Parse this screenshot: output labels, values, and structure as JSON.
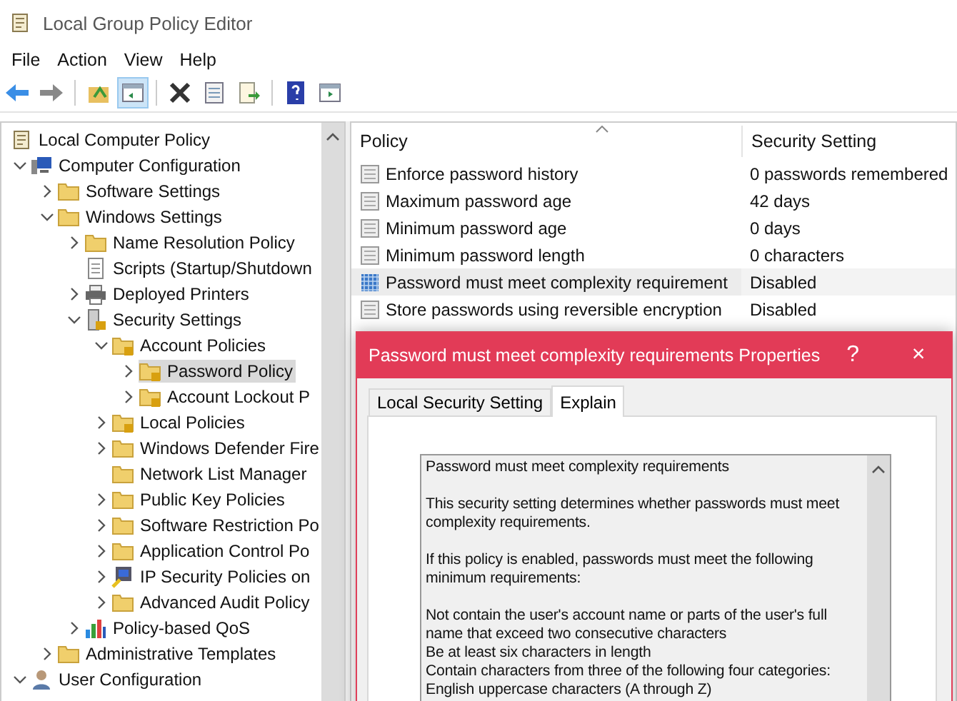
{
  "window": {
    "title": "Local Group Policy Editor"
  },
  "menu": [
    "File",
    "Action",
    "View",
    "Help"
  ],
  "toolbar": [
    {
      "kind": "back",
      "pressed": false
    },
    {
      "kind": "forward",
      "pressed": false
    },
    {
      "kind": "sep"
    },
    {
      "kind": "up",
      "pressed": false
    },
    {
      "kind": "tree",
      "pressed": true
    },
    {
      "kind": "sep"
    },
    {
      "kind": "delete",
      "pressed": false
    },
    {
      "kind": "properties",
      "pressed": false
    },
    {
      "kind": "export",
      "pressed": false
    },
    {
      "kind": "sep"
    },
    {
      "kind": "help",
      "pressed": false
    },
    {
      "kind": "pane",
      "pressed": false
    }
  ],
  "tree": [
    {
      "label": "Local Computer Policy",
      "kind": "scroll",
      "selected": false,
      "children": [
        {
          "label": "Computer Configuration",
          "kind": "computer",
          "expanded": true,
          "selected": false,
          "children": [
            {
              "label": "Software Settings",
              "kind": "folder",
              "expanded": false,
              "selected": false
            },
            {
              "label": "Windows Settings",
              "kind": "folder",
              "expanded": true,
              "selected": false,
              "children": [
                {
                  "label": "Name Resolution Policy",
                  "kind": "folder",
                  "expanded": false,
                  "selected": false
                },
                {
                  "label": "Scripts (Startup/Shutdown",
                  "kind": "script",
                  "selected": false
                },
                {
                  "label": "Deployed Printers",
                  "kind": "printer",
                  "expanded": false,
                  "selected": false
                },
                {
                  "label": "Security Settings",
                  "kind": "security",
                  "expanded": true,
                  "selected": false,
                  "children": [
                    {
                      "label": "Account Policies",
                      "kind": "lockfolder",
                      "expanded": true,
                      "selected": false,
                      "children": [
                        {
                          "label": "Password Policy",
                          "kind": "lockfolder",
                          "expanded": false,
                          "selected": true
                        },
                        {
                          "label": "Account Lockout P",
                          "kind": "lockfolder",
                          "expanded": false,
                          "selected": false
                        }
                      ]
                    },
                    {
                      "label": "Local Policies",
                      "kind": "lockfolder",
                      "expanded": false,
                      "selected": false
                    },
                    {
                      "label": "Windows Defender Fire",
                      "kind": "folder",
                      "expanded": false,
                      "selected": false
                    },
                    {
                      "label": "Network List Manager",
                      "kind": "folder",
                      "selected": false
                    },
                    {
                      "label": "Public Key Policies",
                      "kind": "folder",
                      "expanded": false,
                      "selected": false
                    },
                    {
                      "label": "Software Restriction Po",
                      "kind": "folder",
                      "expanded": false,
                      "selected": false
                    },
                    {
                      "label": "Application Control Po",
                      "kind": "folder",
                      "expanded": false,
                      "selected": false
                    },
                    {
                      "label": "IP Security Policies on",
                      "kind": "ipsec",
                      "expanded": false,
                      "selected": false
                    },
                    {
                      "label": "Advanced Audit Policy",
                      "kind": "folder",
                      "expanded": false,
                      "selected": false
                    }
                  ]
                },
                {
                  "label": "Policy-based QoS",
                  "kind": "chart",
                  "expanded": false,
                  "selected": false
                }
              ]
            },
            {
              "label": "Administrative Templates",
              "kind": "folder",
              "expanded": false,
              "selected": false
            }
          ]
        },
        {
          "label": "User Configuration",
          "kind": "user",
          "expanded": true,
          "selected": false
        }
      ]
    }
  ],
  "table": {
    "columns": [
      "Policy",
      "Security Setting"
    ],
    "rows": [
      {
        "policy": "Enforce password history",
        "setting": "0 passwords remembered",
        "selected": false,
        "kind": "policy"
      },
      {
        "policy": "Maximum password age",
        "setting": "42 days",
        "selected": false,
        "kind": "policy"
      },
      {
        "policy": "Minimum password age",
        "setting": "0 days",
        "selected": false,
        "kind": "policy"
      },
      {
        "policy": "Minimum password length",
        "setting": "0 characters",
        "selected": false,
        "kind": "policy"
      },
      {
        "policy": "Password must meet complexity requirement",
        "setting": "Disabled",
        "selected": true,
        "kind": "active"
      },
      {
        "policy": "Store passwords using reversible encryption",
        "setting": "Disabled",
        "selected": false,
        "kind": "policy"
      }
    ]
  },
  "dialog": {
    "title": "Password must meet complexity requirements Properties",
    "help": "?",
    "close": "×",
    "tabs": [
      {
        "label": "Local Security Setting",
        "selected": false
      },
      {
        "label": "Explain",
        "selected": true
      }
    ],
    "explain": [
      [
        "Password must meet complexity requirements"
      ],
      [
        "This security setting determines whether passwords must meet complexity requirements."
      ],
      [
        "If this policy is enabled, passwords must meet the following minimum requirements:"
      ],
      [
        "Not contain the user's account name or parts of the user's full name that exceed two consecutive characters",
        "Be at least six characters in length",
        "Contain characters from three of the following four categories:",
        "English uppercase characters (A through Z)"
      ]
    ]
  }
}
